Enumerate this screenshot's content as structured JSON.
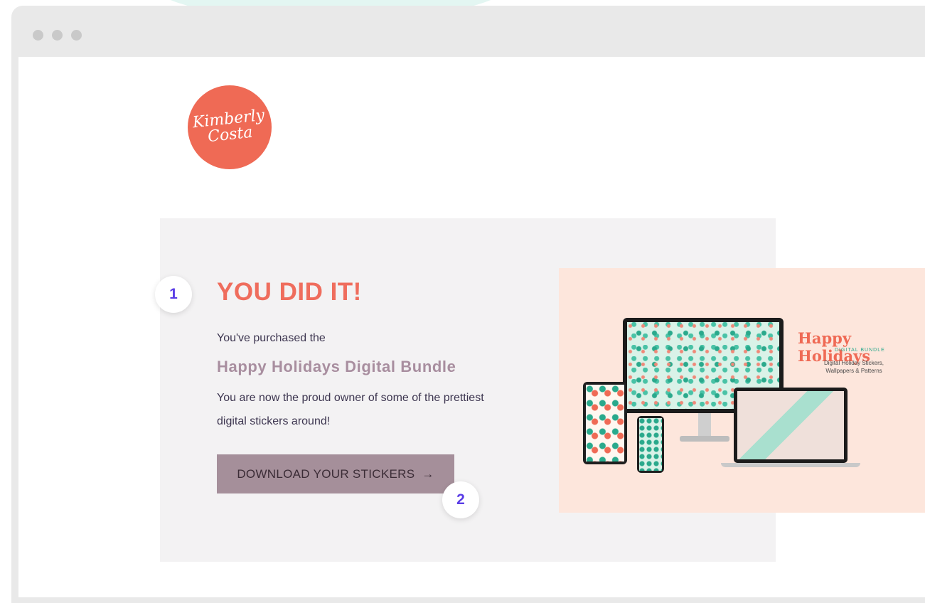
{
  "logo": {
    "line1": "Kimberly",
    "line2": "Costa"
  },
  "card": {
    "headline": "YOU DID IT!",
    "intro": "You've purchased the",
    "product_name": "Happy Holidays Digital Bundle",
    "description": "You are now the proud owner of some of the prettiest digital stickers around!",
    "download_button": {
      "label": "DOWNLOAD YOUR STICKERS",
      "arrow": "→"
    }
  },
  "hero": {
    "title": "Happy Holidays",
    "subtitle": "DIGITAL BUNDLE",
    "description": "Digital Holiday Stickers, Wallpapers & Patterns"
  },
  "badges": {
    "badge_1": "1",
    "badge_2": "2"
  },
  "colors": {
    "accent_coral": "#ef6a55",
    "button_mauve": "#a58f9a",
    "badge_text": "#5a3de6",
    "card_bg": "#f3f2f3"
  }
}
